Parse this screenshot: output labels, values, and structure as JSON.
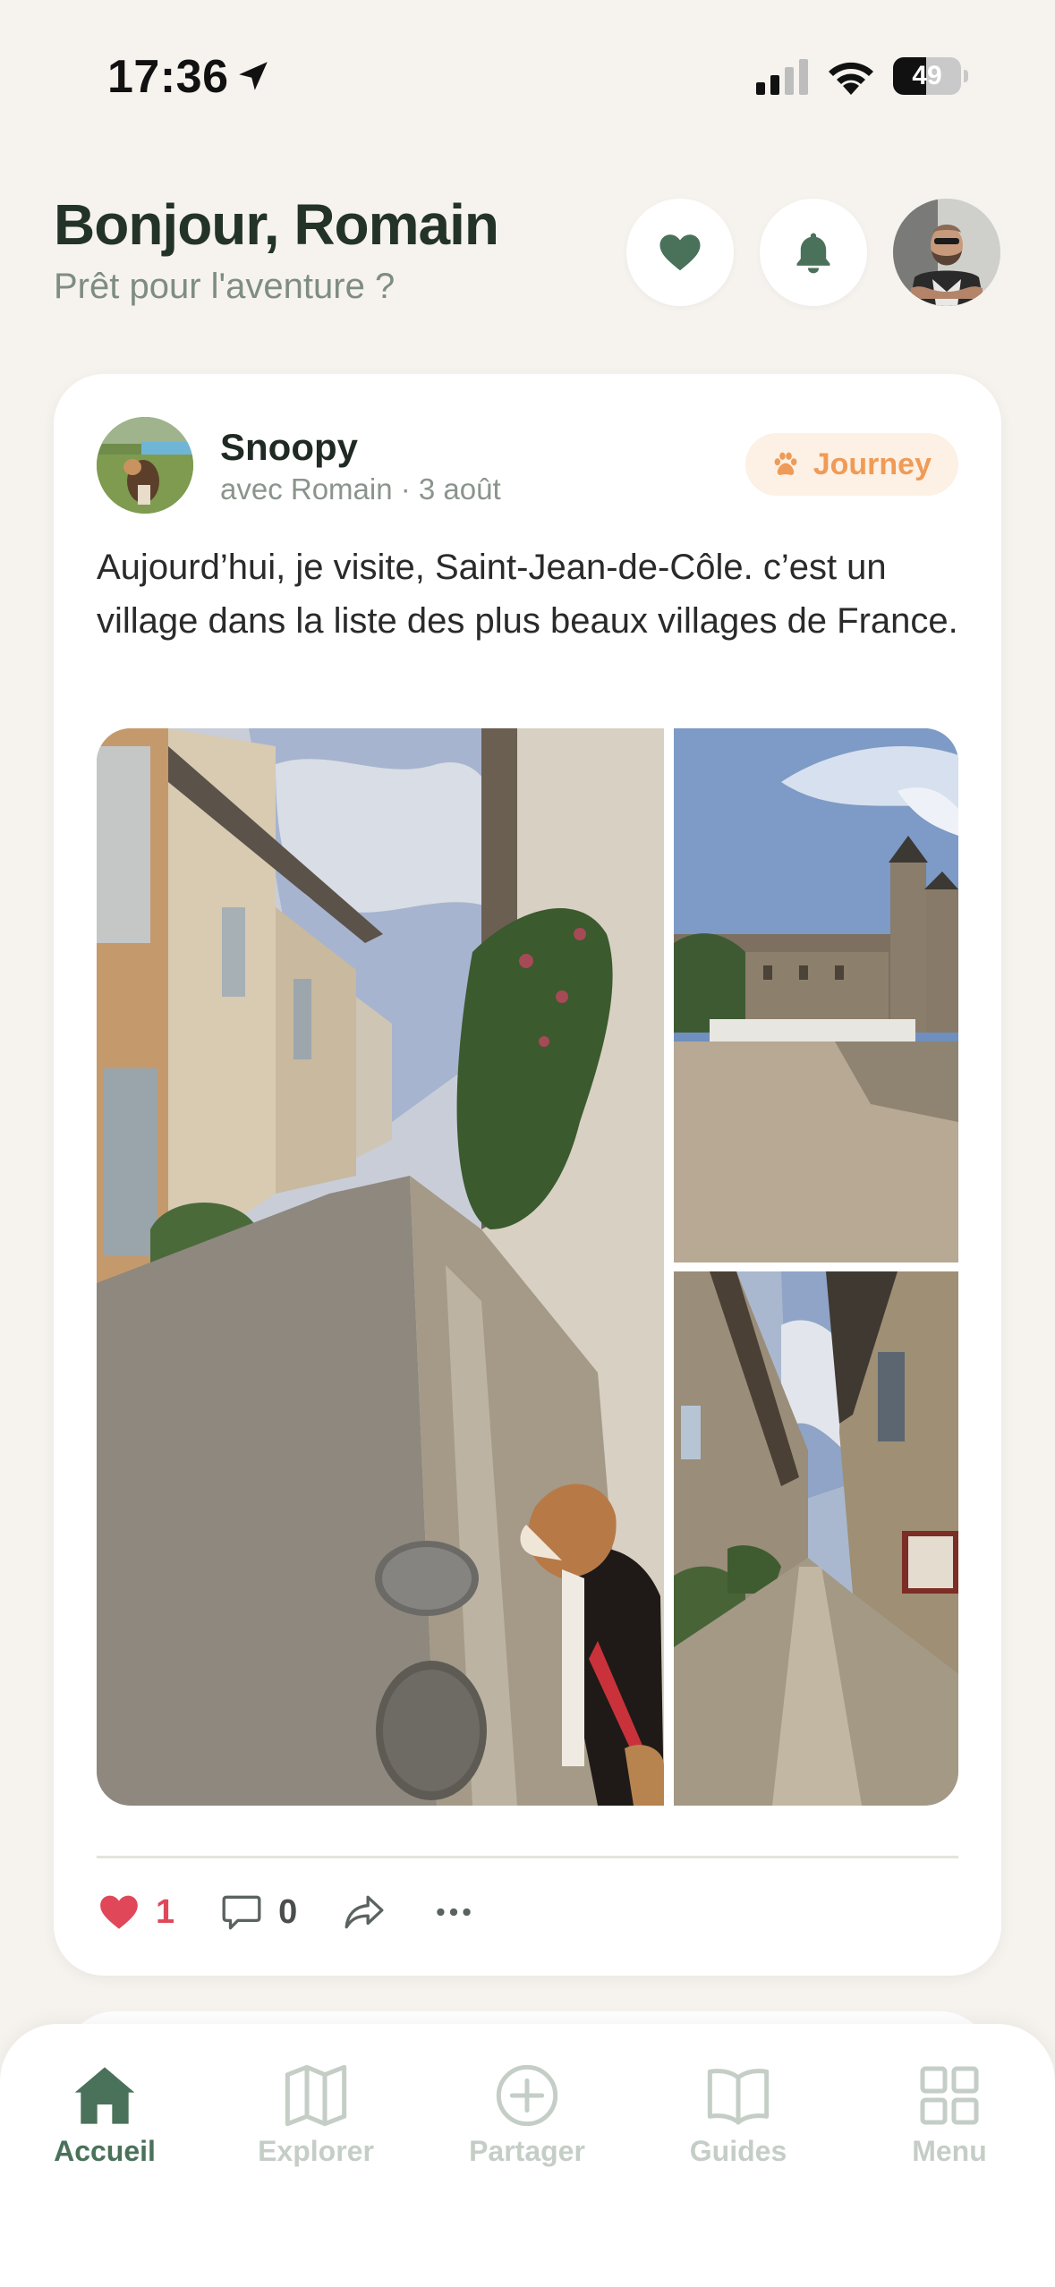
{
  "status_bar": {
    "time": "17:36",
    "battery": "49",
    "battery_level_percent": 49
  },
  "header": {
    "greeting": "Bonjour, Romain",
    "subtitle": "Prêt pour l'aventure ?",
    "icons": [
      "heart-icon",
      "bell-icon",
      "user-avatar"
    ]
  },
  "post": {
    "author": "Snoopy",
    "meta": "avec Romain · 3 août",
    "badge": "Journey",
    "text": "Aujourd’hui, je visite, Saint-Jean-de-Côle. c’est un village dans la liste des plus beaux villages de France.",
    "likes": "1",
    "comments": "0",
    "photo_count": 3
  },
  "nav": {
    "items": [
      {
        "label": "Accueil",
        "icon": "home-icon",
        "active": true
      },
      {
        "label": "Explorer",
        "icon": "map-icon",
        "active": false
      },
      {
        "label": "Partager",
        "icon": "plus-circle-icon",
        "active": false
      },
      {
        "label": "Guides",
        "icon": "book-icon",
        "active": false
      },
      {
        "label": "Menu",
        "icon": "grid-icon",
        "active": false
      }
    ]
  },
  "colors": {
    "background": "#f6f3ee",
    "accent_green": "#4a7159",
    "dark_green": "#233328",
    "badge_orange": "#ef9b57",
    "like_red": "#e0485a",
    "nav_inactive": "#c5cec6"
  }
}
